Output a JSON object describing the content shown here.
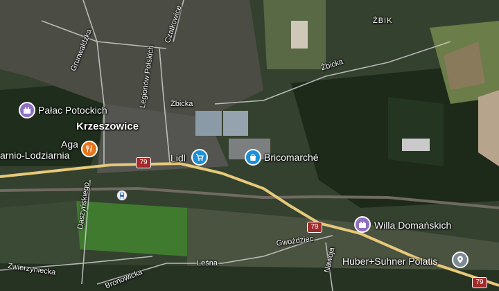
{
  "map": {
    "town": "Krzeszowice",
    "streets": {
      "grunwaldzka": "Grunwaldzka",
      "czatkowice": "Czatkowice",
      "legionow": "Legionów Polskich",
      "zbicka1": "Żbicka",
      "zbicka2": "Żbicka",
      "zbik": "ŻBIK",
      "daszynskiego": "Daszyńskiego",
      "zwierzyniecka": "Zwierzyniecka",
      "bronowicka": "Bronowicka",
      "lesna": "Leśna",
      "gwozdziec": "Gwoździec",
      "nawoja": "Nawoja"
    },
    "road_number": "79",
    "pois": {
      "palac": "Pałac Potockich",
      "aga": "Aga",
      "kawiarnia": "arnio-Lodziarnia",
      "lidl": "Lidl",
      "bricomarche": "Bricomarché",
      "willa": "Willa Domańskich",
      "huber": "Huber+Suhner Polatis"
    },
    "colors": {
      "landmark_pin": "#8e6fc2",
      "restaurant_pin": "#e8731a",
      "shopping_pin": "#1a90d8",
      "place_pin": "#7d8a96",
      "road_shield": "#a12b2b",
      "main_road": "#e7c979"
    }
  }
}
